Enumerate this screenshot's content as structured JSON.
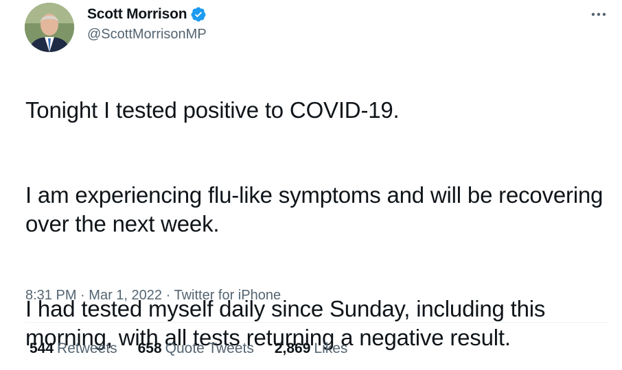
{
  "author": {
    "name": "Scott Morrison",
    "handle": "@ScottMorrisonMP",
    "verified_color": "#1d9bf0"
  },
  "tweet": {
    "paragraphs": [
      "Tonight I tested positive to COVID-19.",
      "I am experiencing flu-like symptoms and will be recovering over the next week.",
      "I had tested myself daily since Sunday, including this morning, with all tests returning a negative result."
    ]
  },
  "meta": {
    "time": "8:31 PM",
    "separator": "·",
    "date": "Mar 1, 2022",
    "source": "Twitter for iPhone"
  },
  "stats": {
    "retweets_count": "544",
    "retweets_label": "Retweets",
    "quotes_count": "658",
    "quotes_label": "Quote Tweets",
    "likes_count": "2,869",
    "likes_label": "Likes"
  },
  "icons": {
    "more": "more-horizontal-icon",
    "verified": "verified-badge-icon"
  }
}
